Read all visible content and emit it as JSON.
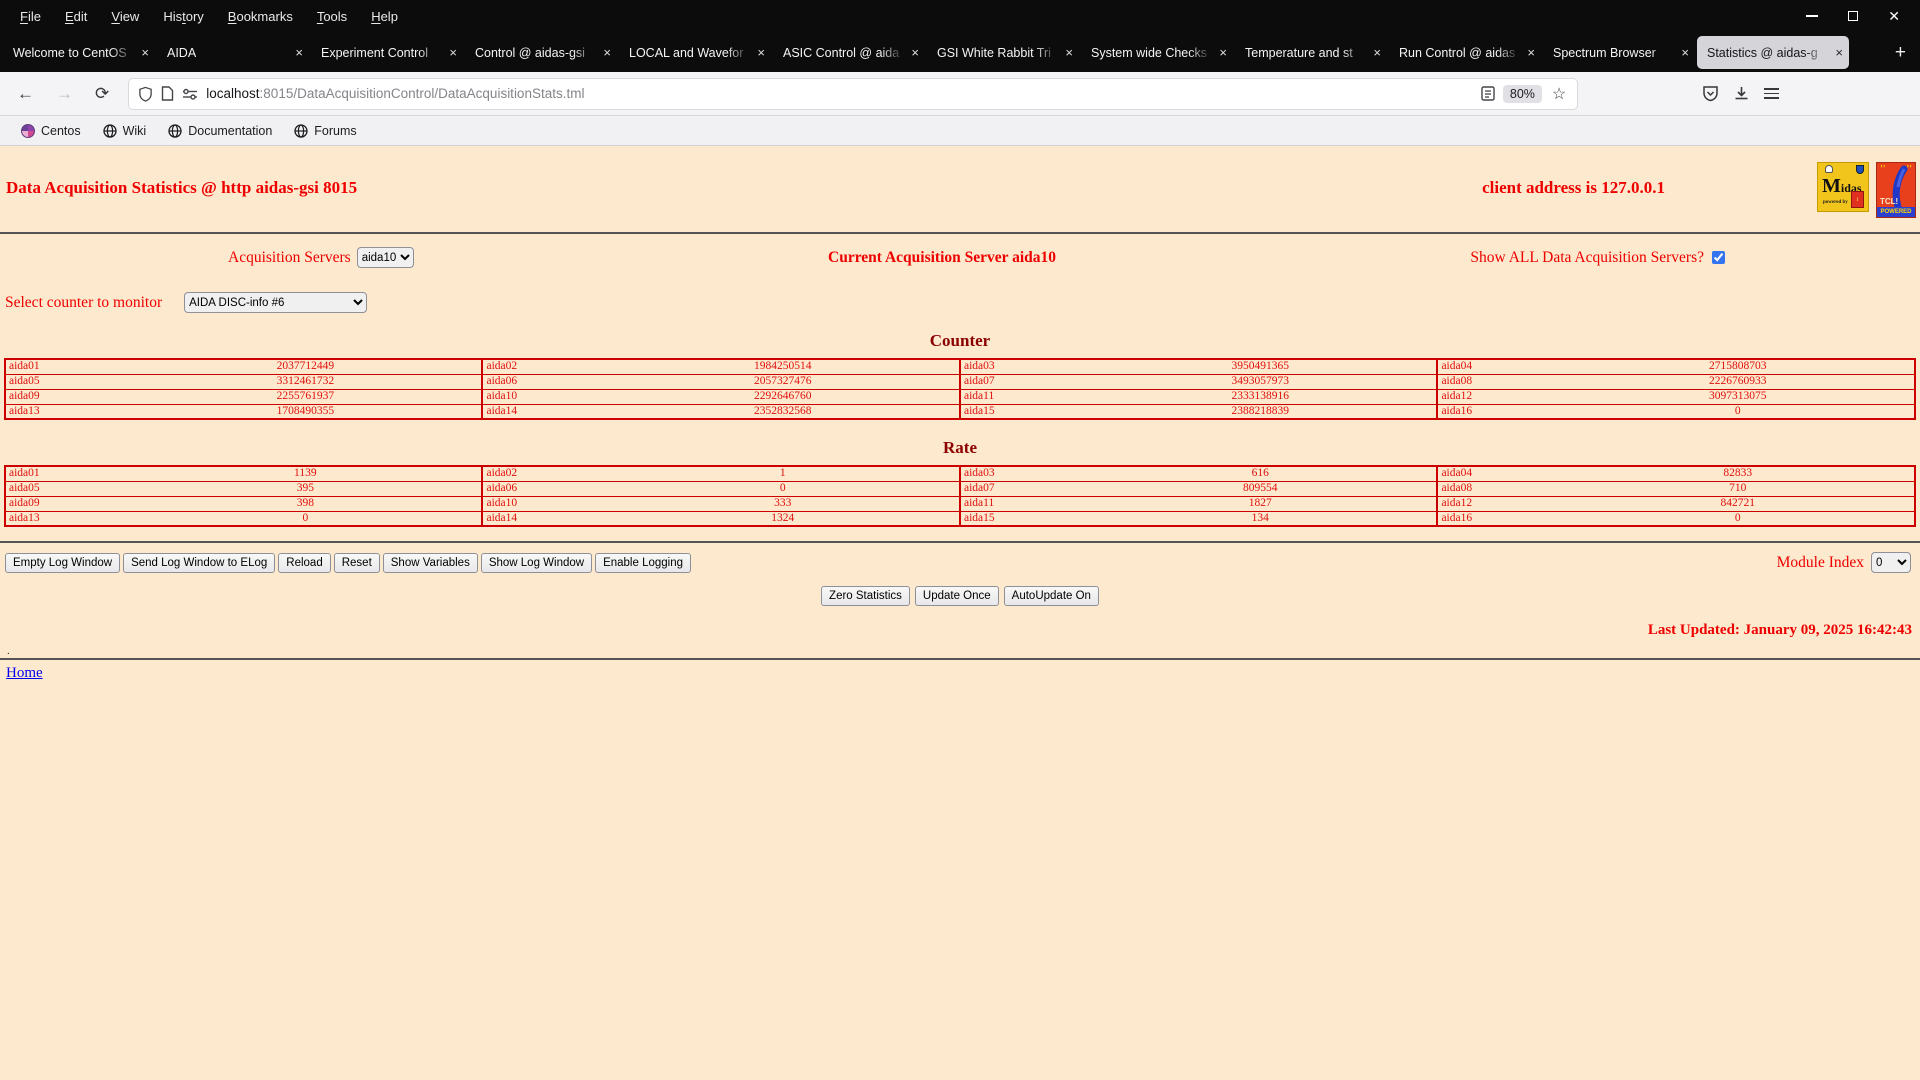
{
  "browser": {
    "menu": [
      {
        "label": "File",
        "accel": 0
      },
      {
        "label": "Edit",
        "accel": 0
      },
      {
        "label": "View",
        "accel": 0
      },
      {
        "label": "History",
        "accel": 3
      },
      {
        "label": "Bookmarks",
        "accel": 0
      },
      {
        "label": "Tools",
        "accel": 0
      },
      {
        "label": "Help",
        "accel": 0
      }
    ],
    "tabs": [
      {
        "label": "Welcome to CentOS",
        "active": false
      },
      {
        "label": "AIDA",
        "active": false
      },
      {
        "label": "Experiment Control",
        "active": false
      },
      {
        "label": "Control @ aidas-gsi",
        "active": false
      },
      {
        "label": "LOCAL and Wavefor",
        "active": false
      },
      {
        "label": "ASIC Control @ aida",
        "active": false
      },
      {
        "label": "GSI White Rabbit Tri",
        "active": false
      },
      {
        "label": "System wide Checks",
        "active": false
      },
      {
        "label": "Temperature and st",
        "active": false
      },
      {
        "label": "Run Control @ aidas",
        "active": false
      },
      {
        "label": "Spectrum Browser",
        "active": false
      },
      {
        "label": "Statistics @ aidas-g",
        "active": true
      }
    ],
    "tab_close_glyph": "×",
    "new_tab_glyph": "+",
    "icons": {
      "back": "←",
      "forward": "→",
      "reload": "⟳",
      "star": "☆",
      "close": "✕"
    },
    "urlbar": {
      "host": "localhost",
      "path": ":8015/DataAcquisitionControl/DataAcquisitionStats.tml",
      "zoom": "80%"
    },
    "bookmarks": [
      {
        "label": "Centos",
        "icon": "centos"
      },
      {
        "label": "Wiki",
        "icon": "globe"
      },
      {
        "label": "Documentation",
        "icon": "globe"
      },
      {
        "label": "Forums",
        "icon": "globe"
      }
    ]
  },
  "page": {
    "title": "Data Acquisition Statistics @ http aidas-gsi 8015",
    "client_address": "client address is 127.0.0.1",
    "logos": {
      "midas_label": "Midas",
      "midas_m": "M",
      "midas_rest": "idas",
      "midas_powered": "powered by",
      "tcl_label": "TCL!",
      "tcl_powered": "POWERED"
    },
    "servers_label": "Acquisition Servers",
    "servers_selected": "aida10",
    "current_server": "Current Acquisition Server aida10",
    "show_all_label": "Show ALL Data Acquisition Servers?",
    "show_all_checked": true,
    "counter_select_label": "Select counter to monitor",
    "counter_select_value": "AIDA DISC-info #6",
    "counter_heading": "Counter",
    "rate_heading": "Rate",
    "counter_rows": [
      [
        [
          "aida01",
          "2037712449"
        ],
        [
          "aida02",
          "1984250514"
        ],
        [
          "aida03",
          "3950491365"
        ],
        [
          "aida04",
          "2715808703"
        ]
      ],
      [
        [
          "aida05",
          "3312461732"
        ],
        [
          "aida06",
          "2057327476"
        ],
        [
          "aida07",
          "3493057973"
        ],
        [
          "aida08",
          "2226760933"
        ]
      ],
      [
        [
          "aida09",
          "2255761937"
        ],
        [
          "aida10",
          "2292646760"
        ],
        [
          "aida11",
          "2333138916"
        ],
        [
          "aida12",
          "3097313075"
        ]
      ],
      [
        [
          "aida13",
          "1708490355"
        ],
        [
          "aida14",
          "2352832568"
        ],
        [
          "aida15",
          "2388218839"
        ],
        [
          "aida16",
          "0"
        ]
      ]
    ],
    "rate_rows": [
      [
        [
          "aida01",
          "1139"
        ],
        [
          "aida02",
          "1"
        ],
        [
          "aida03",
          "616"
        ],
        [
          "aida04",
          "82833"
        ]
      ],
      [
        [
          "aida05",
          "395"
        ],
        [
          "aida06",
          "0"
        ],
        [
          "aida07",
          "809554"
        ],
        [
          "aida08",
          "710"
        ]
      ],
      [
        [
          "aida09",
          "398"
        ],
        [
          "aida10",
          "333"
        ],
        [
          "aida11",
          "1827"
        ],
        [
          "aida12",
          "842721"
        ]
      ],
      [
        [
          "aida13",
          "0"
        ],
        [
          "aida14",
          "1324"
        ],
        [
          "aida15",
          "134"
        ],
        [
          "aida16",
          "0"
        ]
      ]
    ],
    "log_buttons": [
      "Empty Log Window",
      "Send Log Window to ELog",
      "Reload",
      "Reset",
      "Show Variables",
      "Show Log Window",
      "Enable Logging"
    ],
    "module_index_label": "Module Index",
    "module_index_value": "0",
    "action_buttons": [
      "Zero Statistics",
      "Update Once",
      "AutoUpdate On"
    ],
    "last_updated": "Last Updated: January 09, 2025 16:42:43",
    "footer_dot": ".",
    "home_link": "Home",
    "colors": {
      "page_bg": "#FDE9CD",
      "bright_red": "#EE0000",
      "heading_red": "#8B0000",
      "table_border": "#CC0000",
      "link_blue": "#0000EE"
    }
  }
}
